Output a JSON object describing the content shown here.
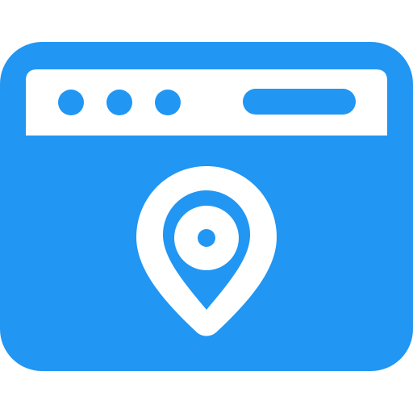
{
  "icon": {
    "name": "web-location-icon",
    "colors": {
      "primary": "#2196F3",
      "secondary": "#FFFFFF"
    }
  }
}
